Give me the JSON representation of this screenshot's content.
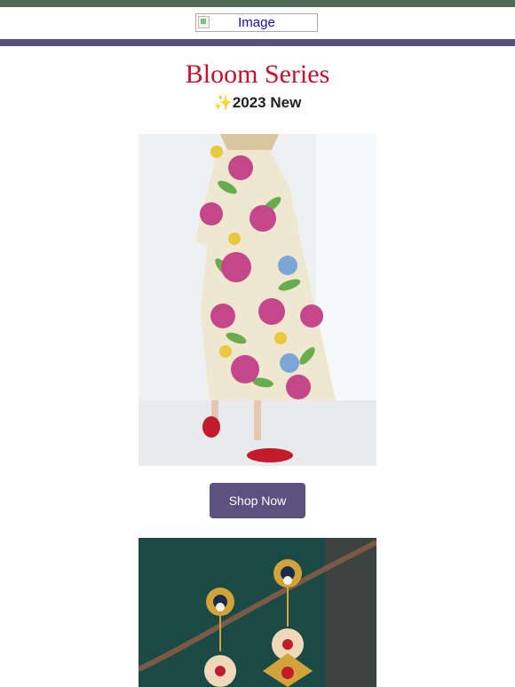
{
  "header": {
    "logo_alt": "Image"
  },
  "hero": {
    "title": "Bloom Series",
    "subtitle": "✨2023 New"
  },
  "cta": {
    "label": "Shop Now"
  },
  "colors": {
    "top_bar": "#4f6b58",
    "divider": "#5b527f",
    "title": "#c8102e",
    "button_bg": "#5b527f",
    "button_text": "#ffffff"
  }
}
